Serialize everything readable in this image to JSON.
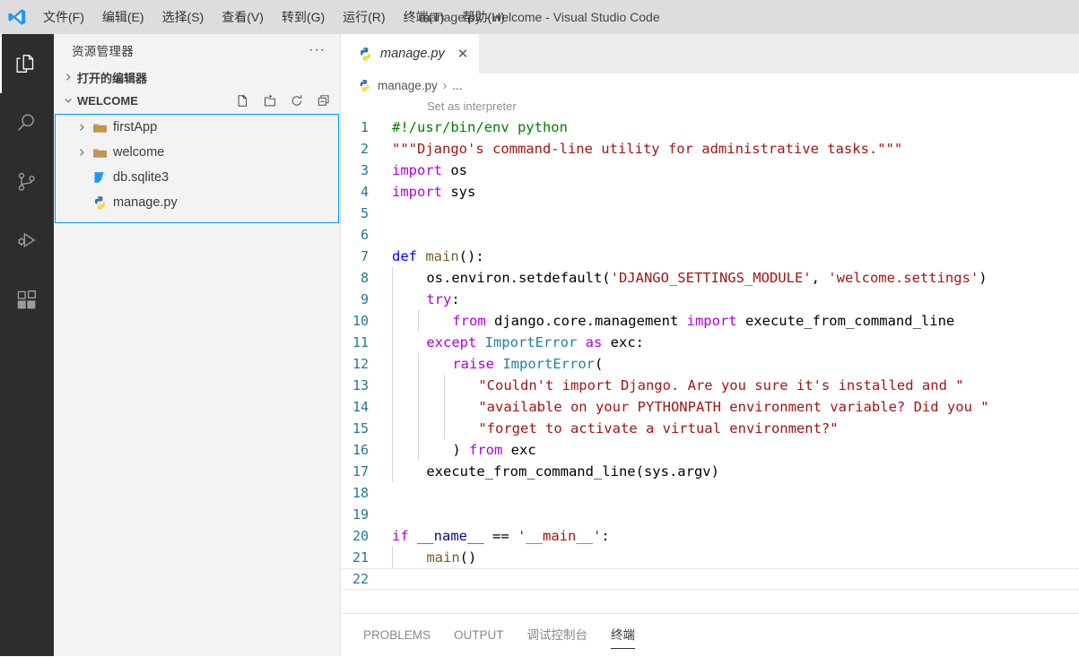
{
  "titlebar": {
    "logo_icon": "vscode-logo-icon",
    "window_title": "manage.py - welcome - Visual Studio Code",
    "menus": [
      {
        "label": "文件(F)",
        "name": "menu-file"
      },
      {
        "label": "编辑(E)",
        "name": "menu-edit"
      },
      {
        "label": "选择(S)",
        "name": "menu-selection"
      },
      {
        "label": "查看(V)",
        "name": "menu-view"
      },
      {
        "label": "转到(G)",
        "name": "menu-go"
      },
      {
        "label": "运行(R)",
        "name": "menu-run"
      },
      {
        "label": "终端(T)",
        "name": "menu-terminal"
      },
      {
        "label": "帮助(H)",
        "name": "menu-help"
      }
    ]
  },
  "activitybar": {
    "items": [
      {
        "name": "activity-explorer",
        "icon": "files-icon",
        "active": true
      },
      {
        "name": "activity-search",
        "icon": "search-icon",
        "active": false
      },
      {
        "name": "activity-source-control",
        "icon": "source-control-icon",
        "active": false
      },
      {
        "name": "activity-run-debug",
        "icon": "run-debug-icon",
        "active": false
      },
      {
        "name": "activity-extensions",
        "icon": "extensions-icon",
        "active": false
      }
    ]
  },
  "sidebar": {
    "title": "资源管理器",
    "more_actions_label": "···",
    "open_editors": {
      "label": "打开的编辑器",
      "expanded": false,
      "chevron": "chevron-right-icon"
    },
    "workspace": {
      "label": "WELCOME",
      "expanded": true,
      "chevron": "chevron-down-icon",
      "actions": [
        {
          "name": "new-file-button",
          "icon": "new-file-icon"
        },
        {
          "name": "new-folder-button",
          "icon": "new-folder-icon"
        },
        {
          "name": "refresh-explorer-button",
          "icon": "refresh-icon"
        },
        {
          "name": "collapse-all-button",
          "icon": "collapse-all-icon"
        }
      ]
    },
    "tree": [
      {
        "label": "firstApp",
        "type": "folder",
        "icon": "folder-icon",
        "chevron": "chevron-right-icon",
        "expandable": true
      },
      {
        "label": "welcome",
        "type": "folder",
        "icon": "folder-icon",
        "chevron": "chevron-right-icon",
        "expandable": true
      },
      {
        "label": "db.sqlite3",
        "type": "file",
        "icon": "sqlite-file-icon",
        "expandable": false
      },
      {
        "label": "manage.py",
        "type": "file",
        "icon": "python-file-icon",
        "expandable": false
      }
    ]
  },
  "editor": {
    "tabs": [
      {
        "label": "manage.py",
        "icon": "python-file-icon",
        "active": true,
        "italic": true,
        "close_label": "✕"
      }
    ],
    "breadcrumb": {
      "icon": "python-file-icon",
      "file": "manage.py",
      "separator": "›",
      "tail": "..."
    },
    "codelens": "Set as interpreter",
    "current_line": 22,
    "lines": [
      {
        "n": 1,
        "text": "#!/usr/bin/env python"
      },
      {
        "n": 2,
        "text": "\"\"\"Django's command-line utility for administrative tasks.\"\"\""
      },
      {
        "n": 3,
        "text": "import os"
      },
      {
        "n": 4,
        "text": "import sys"
      },
      {
        "n": 5,
        "text": ""
      },
      {
        "n": 6,
        "text": ""
      },
      {
        "n": 7,
        "text": "def main():"
      },
      {
        "n": 8,
        "text": "    os.environ.setdefault('DJANGO_SETTINGS_MODULE', 'welcome.settings')"
      },
      {
        "n": 9,
        "text": "    try:"
      },
      {
        "n": 10,
        "text": "        from django.core.management import execute_from_command_line"
      },
      {
        "n": 11,
        "text": "    except ImportError as exc:"
      },
      {
        "n": 12,
        "text": "        raise ImportError("
      },
      {
        "n": 13,
        "text": "            \"Couldn't import Django. Are you sure it's installed and \""
      },
      {
        "n": 14,
        "text": "            \"available on your PYTHONPATH environment variable? Did you \""
      },
      {
        "n": 15,
        "text": "            \"forget to activate a virtual environment?\""
      },
      {
        "n": 16,
        "text": "        ) from exc"
      },
      {
        "n": 17,
        "text": "    execute_from_command_line(sys.argv)"
      },
      {
        "n": 18,
        "text": ""
      },
      {
        "n": 19,
        "text": ""
      },
      {
        "n": 20,
        "text": "if __name__ == '__main__':"
      },
      {
        "n": 21,
        "text": "    main()"
      },
      {
        "n": 22,
        "text": ""
      }
    ]
  },
  "panel": {
    "tabs": [
      {
        "label": "PROBLEMS",
        "name": "panel-tab-problems",
        "active": false
      },
      {
        "label": "OUTPUT",
        "name": "panel-tab-output",
        "active": false
      },
      {
        "label": "调试控制台",
        "name": "panel-tab-debug-console",
        "active": false
      },
      {
        "label": "终端",
        "name": "panel-tab-terminal",
        "active": true
      }
    ]
  },
  "colors": {
    "titlebar_bg": "#dddddd",
    "activitybar_bg": "#2d2d2d",
    "sidebar_bg": "#f3f3f3",
    "editor_bg": "#ffffff",
    "tabbar_bg": "#ececec",
    "focus_border": "#0097fb",
    "linenumber": "#237893",
    "comment": "#008000",
    "string": "#a31515",
    "keyword": "#af00db",
    "def_keyword": "#0000ff",
    "type": "#267f99"
  }
}
